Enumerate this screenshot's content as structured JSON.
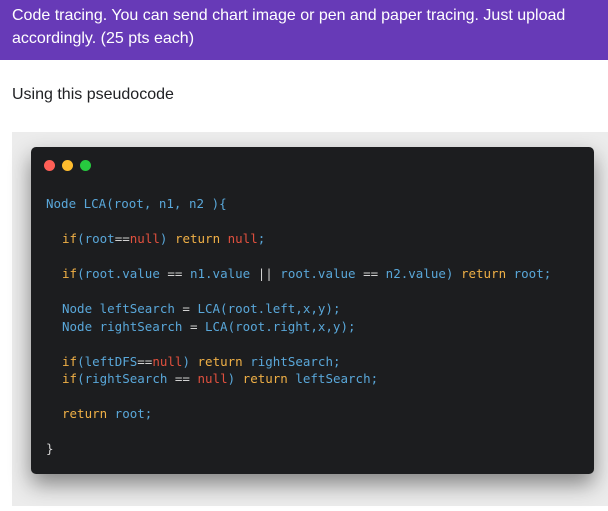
{
  "header": {
    "title": "Code tracing. You can send chart image or pen and paper tracing. Just upload accordingly. (25 pts each)"
  },
  "intro_text": "Using this pseudocode",
  "code_window": {
    "dots": [
      "#ff5f56",
      "#ffbd2e",
      "#27c93f"
    ],
    "lines": [
      {
        "indent": 0,
        "tokens": [
          [
            "Node LCA(root, n1, n2 ){",
            "pl"
          ]
        ]
      },
      {
        "gap": true
      },
      {
        "indent": 1,
        "tokens": [
          [
            "if",
            "kw"
          ],
          [
            "(root",
            "pl"
          ],
          [
            "==",
            "op"
          ],
          [
            "null",
            "null"
          ],
          [
            ") ",
            "pl"
          ],
          [
            "return",
            "kw"
          ],
          [
            " ",
            "pl"
          ],
          [
            "null",
            "null"
          ],
          [
            ";",
            "pl"
          ]
        ]
      },
      {
        "gap": true
      },
      {
        "indent": 1,
        "tokens": [
          [
            "if",
            "kw"
          ],
          [
            "(root.value ",
            "pl"
          ],
          [
            "==",
            "op"
          ],
          [
            " n1.value ",
            "pl"
          ],
          [
            "||",
            "op"
          ],
          [
            " root.value ",
            "pl"
          ],
          [
            "==",
            "op"
          ],
          [
            " n2.value) ",
            "pl"
          ],
          [
            "return",
            "kw"
          ],
          [
            " root;",
            "pl"
          ]
        ]
      },
      {
        "gap": true
      },
      {
        "indent": 1,
        "tokens": [
          [
            "Node leftSearch ",
            "pl"
          ],
          [
            "=",
            "op"
          ],
          [
            " LCA(root.left,x,y);",
            "pl"
          ]
        ]
      },
      {
        "indent": 1,
        "tokens": [
          [
            "Node rightSearch ",
            "pl"
          ],
          [
            "=",
            "op"
          ],
          [
            " LCA(root.right,x,y);",
            "pl"
          ]
        ]
      },
      {
        "gap": true
      },
      {
        "indent": 1,
        "tokens": [
          [
            "if",
            "kw"
          ],
          [
            "(leftDFS",
            "pl"
          ],
          [
            "==",
            "op"
          ],
          [
            "null",
            "null"
          ],
          [
            ") ",
            "pl"
          ],
          [
            "return",
            "kw"
          ],
          [
            " rightSearch;",
            "pl"
          ]
        ]
      },
      {
        "indent": 1,
        "tokens": [
          [
            "if",
            "kw"
          ],
          [
            "(rightSearch ",
            "pl"
          ],
          [
            "==",
            "op"
          ],
          [
            " ",
            "pl"
          ],
          [
            "null",
            "null"
          ],
          [
            ") ",
            "pl"
          ],
          [
            "return",
            "kw"
          ],
          [
            " leftSearch;",
            "pl"
          ]
        ]
      },
      {
        "gap": true
      },
      {
        "indent": 1,
        "tokens": [
          [
            "return",
            "kw"
          ],
          [
            " root;",
            "pl"
          ]
        ]
      },
      {
        "gap": true
      },
      {
        "indent": 0,
        "tokens": [
          [
            "}",
            "op"
          ]
        ]
      }
    ]
  }
}
